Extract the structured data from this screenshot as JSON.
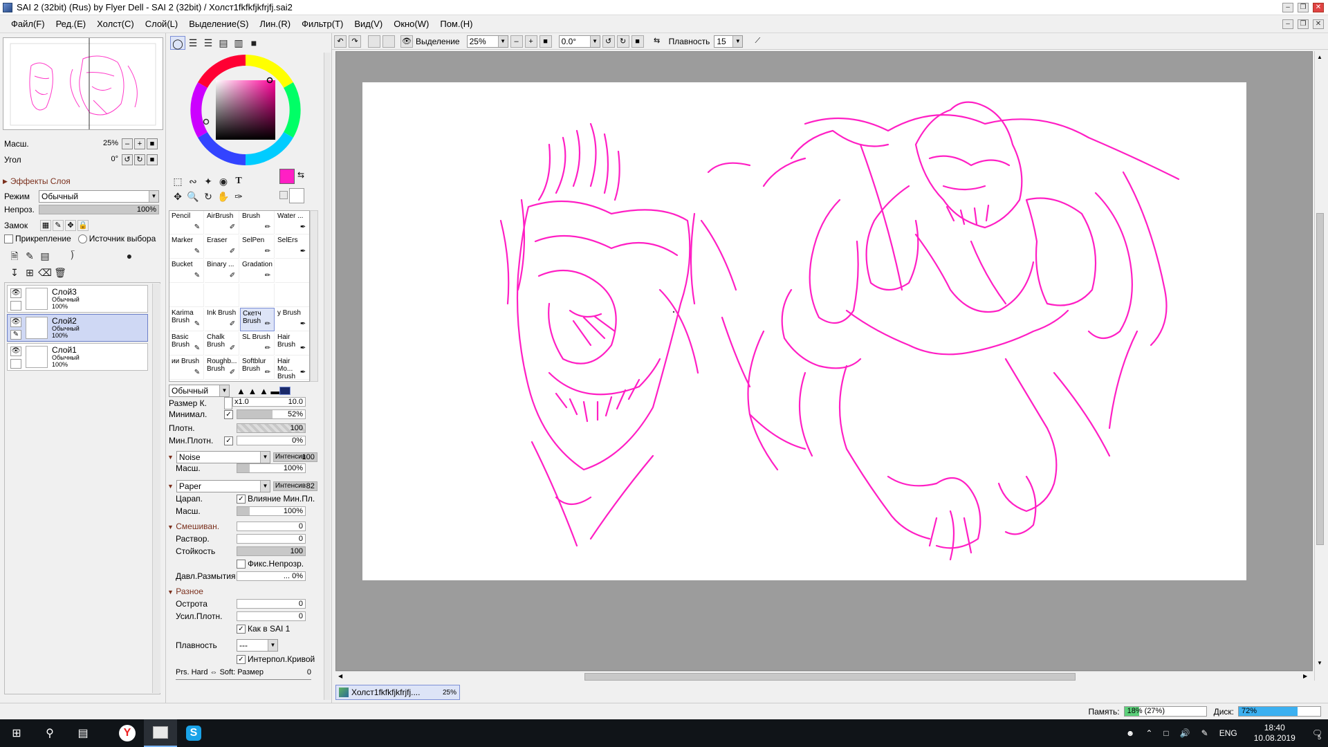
{
  "window": {
    "title": "SAI 2 (32bit) (Rus) by Flyer Dell - SAI 2 (32bit) / Холст1fkfkfjkfrjfj.sai2"
  },
  "menu": [
    "Файл(F)",
    "Ред.(E)",
    "Холст(C)",
    "Слой(L)",
    "Выделение(S)",
    "Лин.(R)",
    "Фильтр(T)",
    "Вид(V)",
    "Окно(W)",
    "Пом.(H)"
  ],
  "navigator": {
    "zoom_label": "Масш.",
    "zoom_value": "25%",
    "angle_label": "Угол",
    "angle_value": "0°"
  },
  "layer_panel": {
    "effects_label": "Эффекты Слоя",
    "mode_label": "Режим",
    "mode_value": "Обычный",
    "opacity_label": "Непроз.",
    "opacity_value": "100%",
    "opacity_fraction": 1.0,
    "lock_label": "Замок",
    "clipping_label": "Прикрепление",
    "selection_source_label": "Источник выбора",
    "layers": [
      {
        "name": "Слой3",
        "mode": "Обычный",
        "opacity": "100%",
        "selected": false
      },
      {
        "name": "Слой2",
        "mode": "Обычный",
        "opacity": "100%",
        "selected": true
      },
      {
        "name": "Слой1",
        "mode": "Обычный",
        "opacity": "100%",
        "selected": false
      }
    ]
  },
  "color": {
    "primary": "#ff1fc4",
    "secondary": "#ffffff"
  },
  "tools": {
    "brushes": [
      {
        "label": "Pencil"
      },
      {
        "label": "AirBrush"
      },
      {
        "label": "Brush"
      },
      {
        "label": "Water ..."
      },
      {
        "label": "Marker"
      },
      {
        "label": "Eraser"
      },
      {
        "label": "SelPen"
      },
      {
        "label": "SelErs"
      },
      {
        "label": "Bucket"
      },
      {
        "label": "Binary ..."
      },
      {
        "label": "Gradation"
      },
      {
        "label": ""
      },
      {
        "label": ""
      },
      {
        "label": ""
      },
      {
        "label": ""
      },
      {
        "label": ""
      },
      {
        "label": "Karima Brush"
      },
      {
        "label": "Ink Brush"
      },
      {
        "label": "Скетч Brush",
        "selected": true
      },
      {
        "label": "у Brush"
      },
      {
        "label": "Basic Brush"
      },
      {
        "label": "Chalk Brush"
      },
      {
        "label": "SL Brush"
      },
      {
        "label": "Hair Brush"
      },
      {
        "label": "ии Brush"
      },
      {
        "label": "Roughb... Brush"
      },
      {
        "label": "Softblur Brush"
      },
      {
        "label": "Hair Mo... Brush"
      }
    ]
  },
  "brush_settings": {
    "blend_mode": "Обычный",
    "size_label": "Размер К.",
    "size_mult": "x1.0",
    "size_value": "10.0",
    "min_label": "Минимал.",
    "min_value": "52%",
    "min_fraction": 0.52,
    "density_label": "Плотн.",
    "density_value": "100",
    "min_density_label": "Мин.Плотн.",
    "min_density_value": "0%",
    "texture1": "Noise",
    "intensity_label": "Интенсив",
    "texture1_intensity": "100",
    "texture1_scale_label": "Масш.",
    "texture1_scale": "100%",
    "texture2": "Paper",
    "texture2_intensity": "82",
    "scratch_label": "Царап.",
    "min_influence_label": "Влияние Мин.Пл.",
    "texture2_scale_label": "Масш.",
    "texture2_scale": "100%",
    "mixing_label": "Смешиван.",
    "mixing_value": "0",
    "dilution_label": "Раствор.",
    "dilution_value": "0",
    "persistence_label": "Стойкость",
    "persistence_value": "100",
    "fix_opacity_label": "Фикс.Непрозр.",
    "blur_pressure_label": "Давл.Размытия",
    "blur_pressure_value": "... 0%",
    "misc_label": "Разное",
    "sharpness_label": "Острота",
    "sharpness_value": "0",
    "density_boost_label": "Усил.Плотн.",
    "density_boost_value": "0",
    "like_sai1_label": "Как в SAI 1",
    "stabilizer_label": "Плавность",
    "stabilizer_value": "---",
    "curve_interp_label": "Интерпол.Кривой",
    "pressure_label": "Prs. Hard ⇔ Soft: Размер",
    "pressure_value": "0"
  },
  "toolbar": {
    "selection_label": "Выделение",
    "zoom_value": "25%",
    "angle_value": "0.0°",
    "stabilizer_label": "Плавность",
    "stabilizer_value": "15"
  },
  "document_tab": {
    "name": "Холст1fkfkfjkfrjfj....",
    "zoom": "25%"
  },
  "status": {
    "memory_label": "Память:",
    "memory_value": "18% (27%)",
    "memory_fraction": 0.18,
    "disk_label": "Диск:",
    "disk_value": "72%",
    "disk_fraction": 0.72
  },
  "taskbar": {
    "lang": "ENG",
    "time": "18:40",
    "date": "10.08.2019",
    "notifications": "5"
  },
  "icons": [
    "windows-icon",
    "search-icon",
    "task-view-icon",
    "yandex-browser-icon",
    "sai-icon",
    "skype-icon"
  ]
}
